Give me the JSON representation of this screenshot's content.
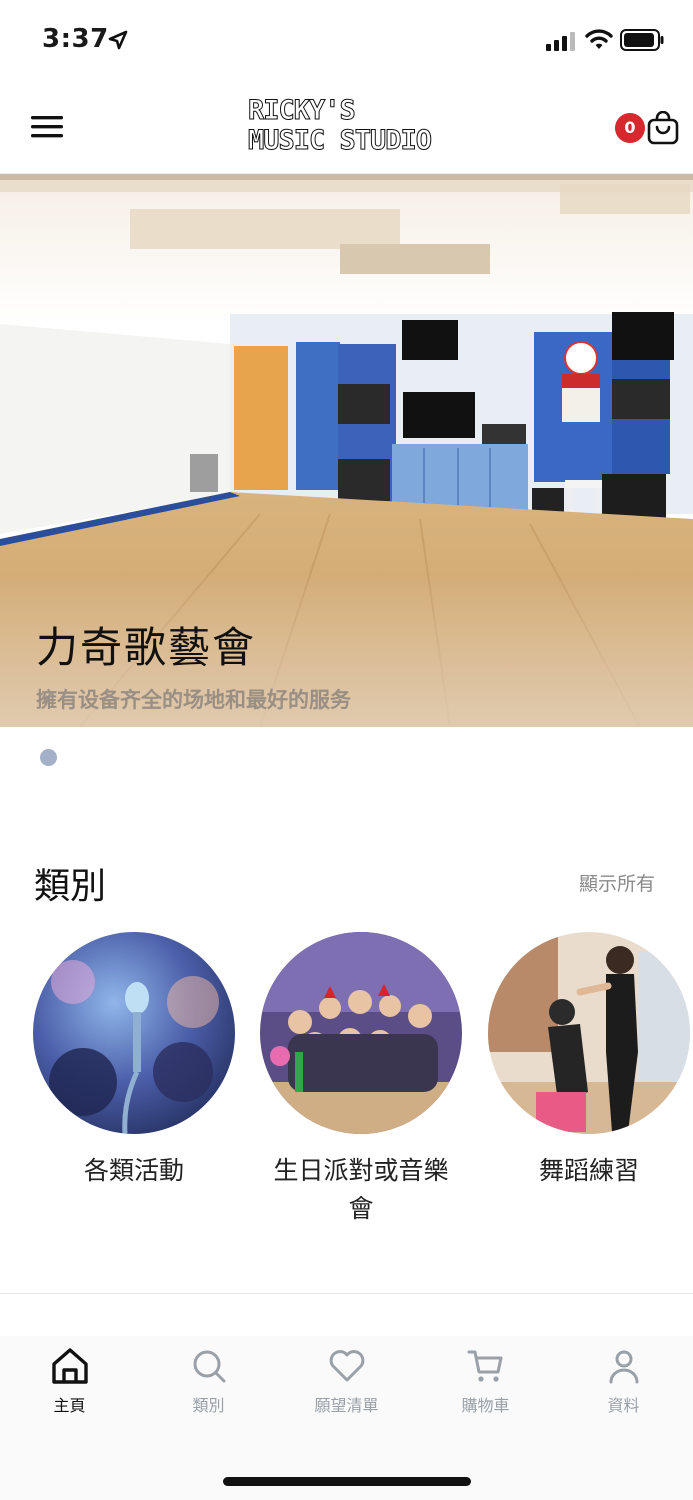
{
  "status_bar": {
    "time": "3:37"
  },
  "header": {
    "logo_line1": "RICKY'S",
    "logo_line2": "MUSIC STUDIO",
    "cart_count": "0"
  },
  "hero": {
    "title": "力奇歌藝會",
    "subtitle": "擁有设备齐全的场地和最好的服务"
  },
  "categories": {
    "title": "類別",
    "show_all": "顯示所有",
    "items": [
      {
        "label": "各類活動"
      },
      {
        "label": "生日派對或音樂會"
      },
      {
        "label": "舞蹈練習"
      }
    ]
  },
  "tab_bar": {
    "items": [
      {
        "label": "主頁",
        "icon": "home-icon",
        "active": true
      },
      {
        "label": "類別",
        "icon": "search-icon",
        "active": false
      },
      {
        "label": "願望清單",
        "icon": "heart-icon",
        "active": false
      },
      {
        "label": "購物車",
        "icon": "cart-icon",
        "active": false
      },
      {
        "label": "資料",
        "icon": "user-icon",
        "active": false
      }
    ]
  },
  "colors": {
    "badge": "#d6282e",
    "pager_dot": "#a3b0c8",
    "inactive_tab": "#9aa0a8"
  }
}
